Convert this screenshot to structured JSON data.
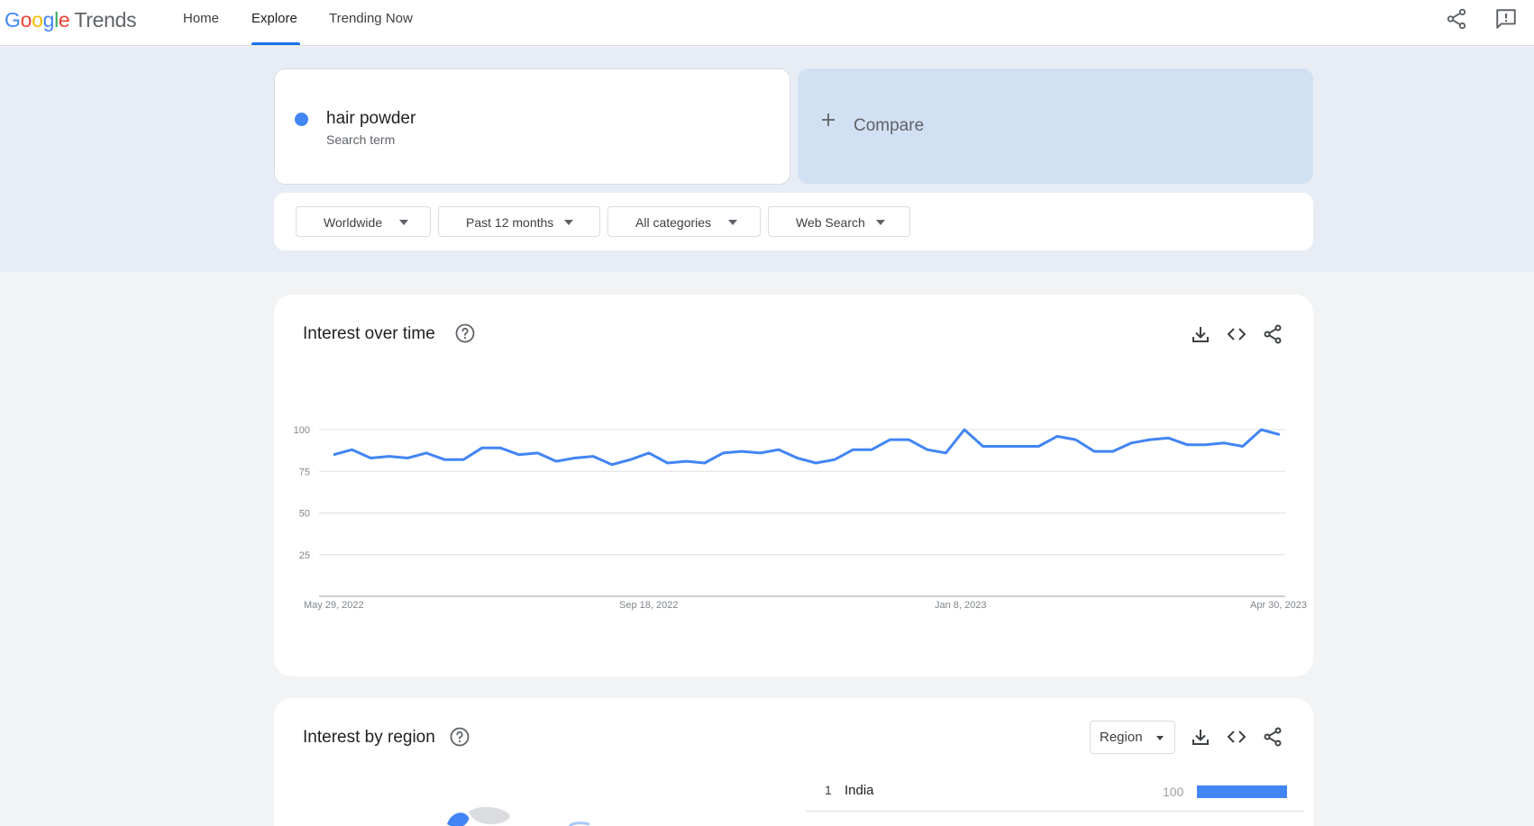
{
  "header": {
    "logo_brand": [
      "G",
      "o",
      "o",
      "g",
      "l",
      "e"
    ],
    "logo_product": "Trends",
    "nav": [
      {
        "label": "Home"
      },
      {
        "label": "Explore"
      },
      {
        "label": "Trending Now"
      }
    ],
    "active_nav": "Explore"
  },
  "search": {
    "term": "hair powder",
    "term_type": "Search term",
    "term_color": "#4285f4",
    "compare_label": "Compare"
  },
  "filters": [
    {
      "label": "Worldwide"
    },
    {
      "label": "Past 12 months"
    },
    {
      "label": "All categories"
    },
    {
      "label": "Web Search"
    }
  ],
  "interest_over_time": {
    "title": "Interest over time",
    "chart_data": {
      "type": "line",
      "x_ticks": [
        "May 29, 2022",
        "Sep 18, 2022",
        "Jan 8, 2023",
        "Apr 30, 2023"
      ],
      "y_ticks": [
        100,
        75,
        50,
        25
      ],
      "ylim": [
        0,
        100
      ],
      "grid": true,
      "series": [
        {
          "color": "#4285f4",
          "values": [
            85,
            88,
            83,
            84,
            83,
            86,
            82,
            82,
            89,
            89,
            85,
            86,
            81,
            83,
            84,
            79,
            82,
            86,
            80,
            81,
            80,
            86,
            87,
            86,
            88,
            83,
            80,
            82,
            88,
            88,
            94,
            94,
            88,
            86,
            100,
            90,
            90,
            90,
            90,
            96,
            94,
            87,
            87,
            92,
            94,
            95,
            91,
            91,
            92,
            90,
            100,
            97
          ]
        }
      ]
    }
  },
  "interest_by_region": {
    "title": "Interest by region",
    "region_select": "Region",
    "rows": [
      {
        "rank": "1",
        "name": "India",
        "value": "100",
        "fraction": 1.0
      }
    ]
  }
}
